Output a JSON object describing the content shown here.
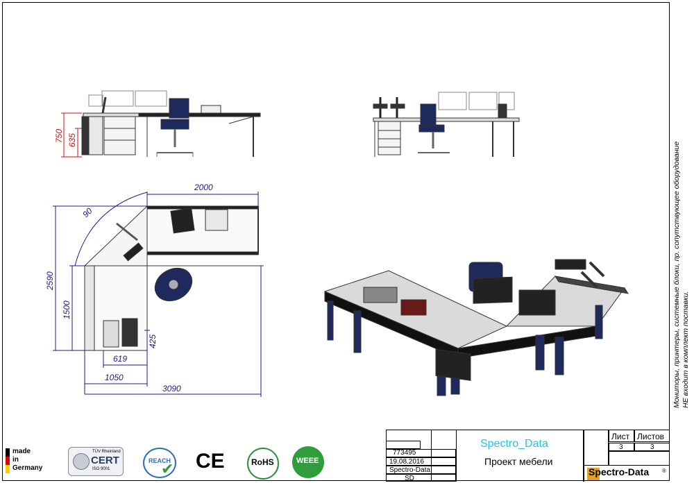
{
  "drawing": {
    "dimensions": {
      "height_desk": "750",
      "height_pedestal": "635",
      "width_top": "2000",
      "angle": "90",
      "depth_total": "2590",
      "depth_side": "1500",
      "keyboard_offset": "425",
      "tray_width": "619",
      "side_width": "1050",
      "total_width": "3090"
    }
  },
  "note": {
    "line1": "Мониторы, принтеры, системные блоки, пр. сопутствующее оборудование",
    "line2": "НЕ входит в комплект поставки."
  },
  "title_block": {
    "order_no": "773495",
    "date": "19.08.2016",
    "company": "Spectro-Data",
    "author": "SD",
    "client_name": "Spectro_Data",
    "project": "Проект мебели",
    "sheet_label": "Лист",
    "sheets_label": "Листов",
    "sheet": "3",
    "sheets": "3",
    "brand": "Spectro-Data",
    "brand_mark": "®"
  },
  "badges": {
    "made_line1": "made",
    "made_line2": "in",
    "made_line3": "Germany",
    "cert_top": "TÜV Rheinland",
    "cert_main": "CERT",
    "cert_sub": "ISO 9001",
    "reach": "REACH",
    "ce": "CE",
    "rohs": "RoHS",
    "weee": "WEEE"
  },
  "colors": {
    "dimension_blue": "#1a1a8c",
    "dimension_red": "#cc1111",
    "chair_blue": "#1f2a5c",
    "brand_orange": "#e8a020",
    "client_cyan": "#22c3e6"
  }
}
